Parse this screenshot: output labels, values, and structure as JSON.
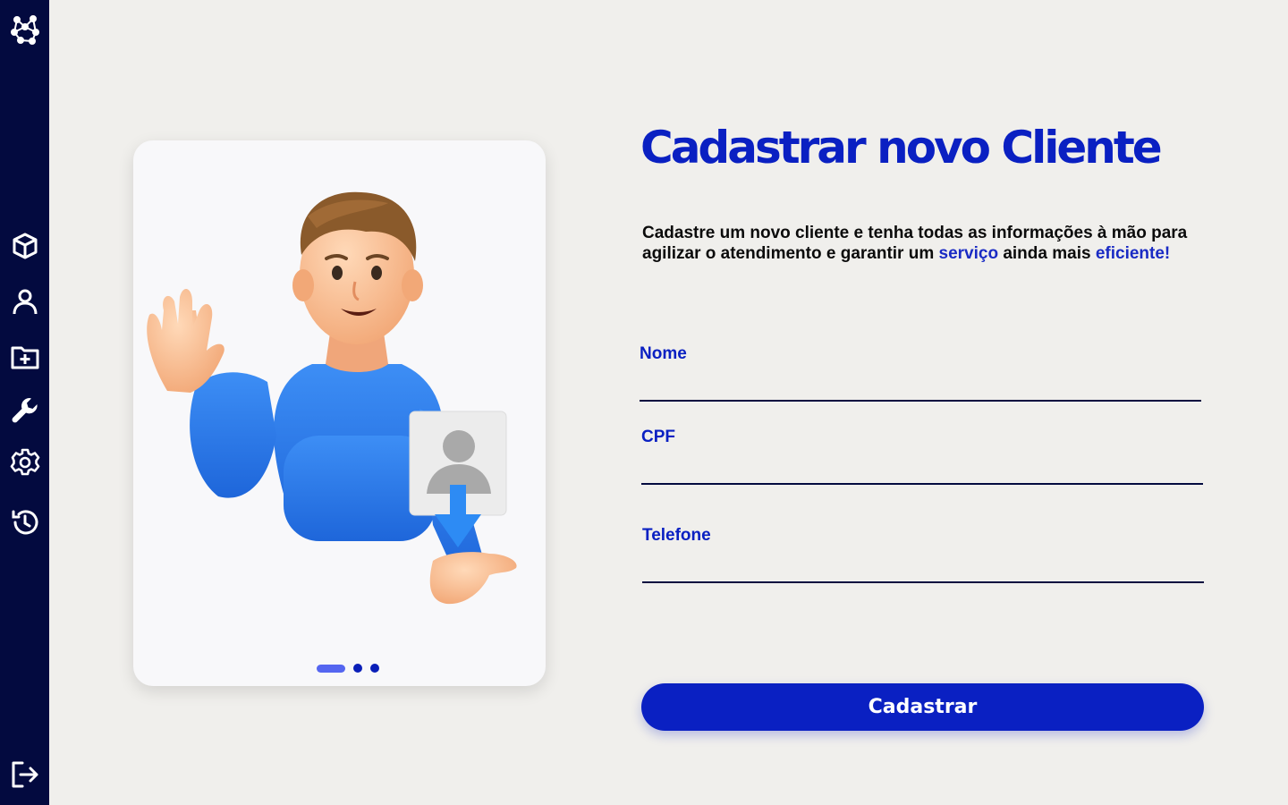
{
  "sidebar": {
    "items": [
      {
        "name": "logo-network-icon"
      },
      {
        "name": "cube-icon"
      },
      {
        "name": "user-icon"
      },
      {
        "name": "folder-add-icon"
      },
      {
        "name": "wrench-icon"
      },
      {
        "name": "gear-icon"
      },
      {
        "name": "history-icon"
      },
      {
        "name": "logout-icon"
      }
    ],
    "background": "#030a3f"
  },
  "illustration": {
    "carousel_pages": 3,
    "active_page": 1
  },
  "main": {
    "title": "Cadastrar novo Cliente",
    "description_parts": [
      "Cadastre um novo cliente e tenha todas as informações à mão para agilizar o atendimento e garantir um ",
      "serviço",
      " ainda mais ",
      "eficiente!"
    ],
    "fields": [
      {
        "label": "Nome",
        "value": "",
        "placeholder": ""
      },
      {
        "label": "CPF",
        "value": "",
        "placeholder": ""
      },
      {
        "label": "Telefone",
        "value": "",
        "placeholder": ""
      }
    ],
    "submit_label": "Cadastrar"
  },
  "colors": {
    "accent": "#0a20c2",
    "background": "#f0efec",
    "sidebar": "#030a3f"
  }
}
